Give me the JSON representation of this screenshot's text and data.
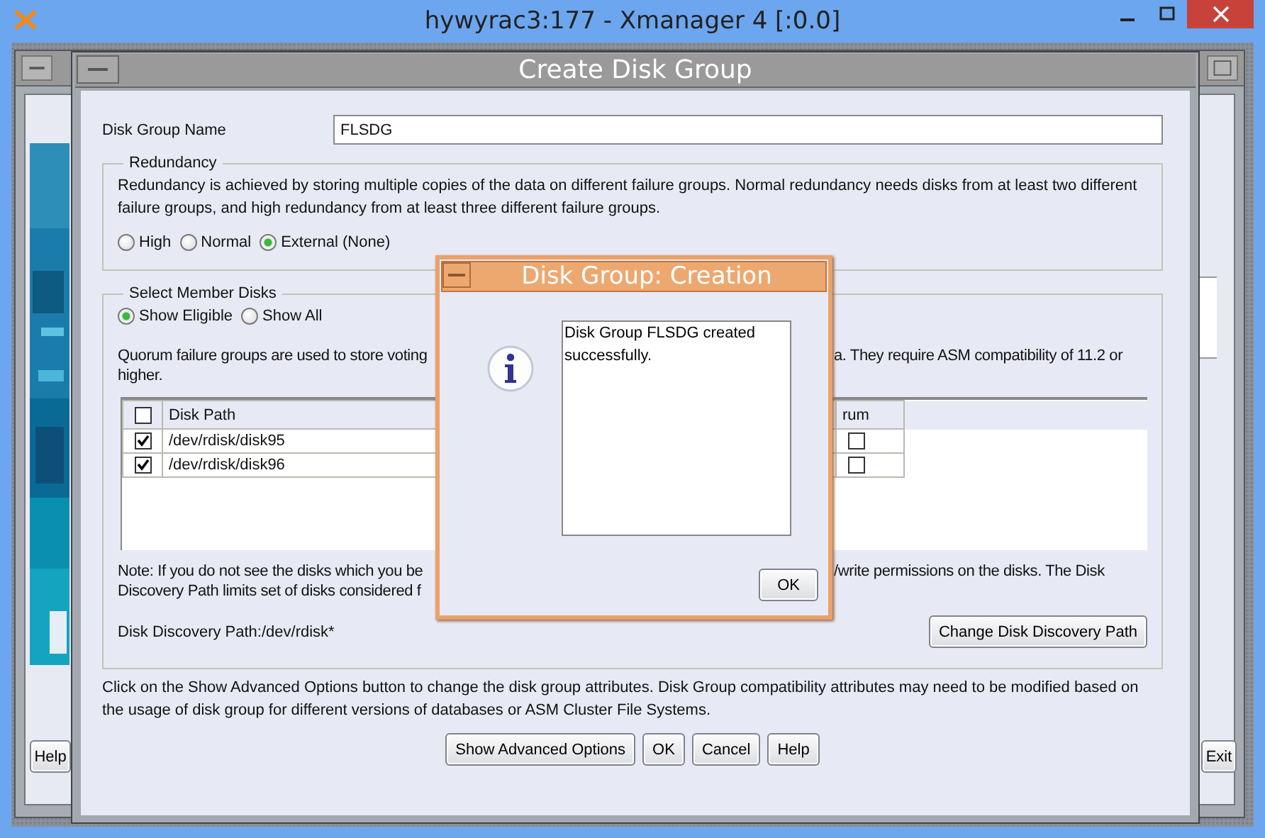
{
  "xmanager": {
    "title": "hywyrac3:177 - Xmanager 4 [:0.0]"
  },
  "background_window": {
    "left_button": "Help",
    "right_button": "Exit"
  },
  "create_dialog": {
    "title": "Create Disk Group",
    "name_label": "Disk Group Name",
    "name_value": "FLSDG",
    "redundancy": {
      "legend": "Redundancy",
      "description": "Redundancy is achieved by storing multiple copies of the data on different failure groups. Normal redundancy needs disks from at least two different failure groups, and high redundancy from at least three different failure groups.",
      "options": [
        {
          "label": "High",
          "selected": false
        },
        {
          "label": "Normal",
          "selected": false
        },
        {
          "label": "External (None)",
          "selected": true
        }
      ]
    },
    "member_disks": {
      "legend": "Select Member Disks",
      "filters": [
        {
          "label": "Show Eligible",
          "selected": true
        },
        {
          "label": "Show All",
          "selected": false
        }
      ],
      "quorum_note_left": "Quorum failure groups are used to store voting",
      "quorum_note_right": "a. They require ASM compatibility of 11.2 or",
      "quorum_note_end": "higher.",
      "table": {
        "header_checked": false,
        "columns": [
          "Disk Path",
          "rum"
        ],
        "rows": [
          {
            "checked": true,
            "path": "/dev/rdisk/disk95",
            "quorum": false
          },
          {
            "checked": true,
            "path": "/dev/rdisk/disk96",
            "quorum": false
          }
        ]
      },
      "note_1_left": "Note: If you do not see the disks which you be",
      "note_1_right": "/write permissions on the disks. The Disk",
      "note_2_left": "Discovery Path limits set of disks considered f",
      "discovery_path": "Disk Discovery Path:/dev/rdisk*",
      "change_button": "Change Disk Discovery Path"
    },
    "advanced_note": "Click on the Show Advanced Options button to change the disk group attributes. Disk Group compatibility attributes may need to be modified based on the usage of disk group for different versions of databases or ASM Cluster File Systems.",
    "buttons": [
      "Show Advanced Options",
      "OK",
      "Cancel",
      "Help"
    ]
  },
  "message_dialog": {
    "title": "Disk Group: Creation",
    "message": "Disk Group FLSDG created successfully.",
    "button": "OK"
  }
}
